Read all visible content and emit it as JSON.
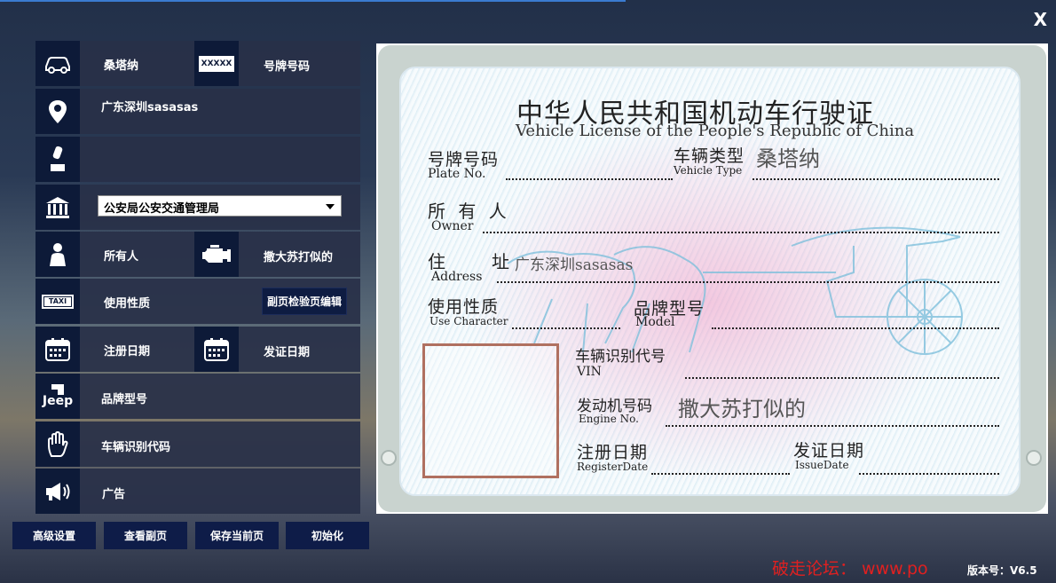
{
  "window": {
    "close": "X",
    "version_label": "版本号：V6.5",
    "watermark": "破走论坛： www.po"
  },
  "left": {
    "car_type": "桑塔纳",
    "plate_label": "号牌号码",
    "plate_icon_text": "XXXXX",
    "address": "广东深圳sasasas",
    "authority": "公安局公安交通管理局",
    "owner_label": "所有人",
    "engine_value": "撒大苏打似的",
    "use_label": "使用性质",
    "inspection_button": "副页检验页编辑",
    "reg_date_label": "注册日期",
    "issue_date_label": "发证日期",
    "brand_label": "品牌型号",
    "jeep_text": "Jeep",
    "vin_label": "车辆识别代码",
    "ad_label": "广告",
    "taxi_text": "TAXI"
  },
  "buttons": {
    "advanced": "高级设置",
    "view_sub": "查看副页",
    "save": "保存当前页",
    "init": "初始化"
  },
  "card": {
    "title_cn": "中华人民共和国机动车行驶证",
    "title_en": "Vehicle License of the People's Republic of China",
    "plate_cn": "号牌号码",
    "plate_en": "Plate No.",
    "type_cn": "车辆类型",
    "type_en": "Vehicle Type",
    "type_val": "桑塔纳",
    "owner_cn": "所 有 人",
    "owner_en": "Owner",
    "addr_cn": "住　　址",
    "addr_en": "Address",
    "addr_val": "广东深圳sasasas",
    "use_cn": "使用性质",
    "use_en": "Use Character",
    "model_cn": "品牌型号",
    "model_en": "Model",
    "vin_cn": "车辆识别代号",
    "vin_en": "VIN",
    "engine_cn": "发动机号码",
    "engine_en": "Engine No.",
    "engine_val": "撒大苏打似的",
    "reg_cn": "注册日期",
    "reg_en": "RegisterDate",
    "issue_cn": "发证日期",
    "issue_en": "IssueDate"
  }
}
